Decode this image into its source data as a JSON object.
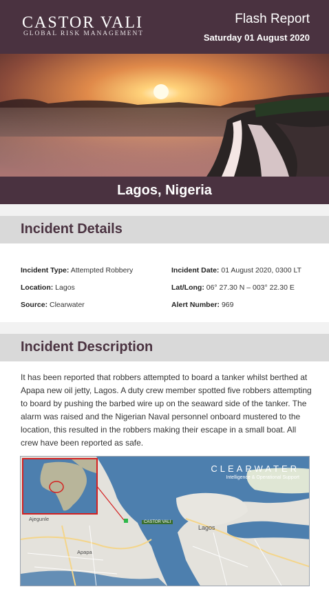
{
  "header": {
    "logo_main": "CASTOR VALI",
    "logo_sub": "GLOBAL RISK MANAGEMENT",
    "report_title": "Flash Report",
    "report_date": "Saturday 01 August 2020"
  },
  "location": "Lagos, Nigeria",
  "incident_details": {
    "heading": "Incident Details",
    "fields": [
      {
        "label": "Incident Type:",
        "value": "Attempted Robbery"
      },
      {
        "label": "Incident Date:",
        "value": "01 August 2020, 0300 LT"
      },
      {
        "label": "Location:",
        "value": "Lagos"
      },
      {
        "label": "Lat/Long:",
        "value": "06° 27.30 N – 003° 22.30 E"
      },
      {
        "label": "Source:",
        "value": "Clearwater"
      },
      {
        "label": "Alert Number:",
        "value": "969"
      }
    ]
  },
  "incident_description": {
    "heading": "Incident Description",
    "text": "It has been reported that robbers attempted to board a tanker whilst berthed at Apapa new oil jetty, Lagos. A duty crew member spotted five robbers attempting to board by pushing the barbed wire up on the seaward side of the tanker. The alarm was raised and the Nigerian Naval personnel onboard mustered to the location, this resulted in the robbers making their escape in a small boat. All crew have been reported as safe."
  },
  "map": {
    "brand": "CLEARWATER",
    "brand_sub": "Intelligence & Operational Support",
    "pin_label": "CASTOR VALI",
    "labels": {
      "lagos": "Lagos",
      "apapa": "Apapa",
      "ajegunle": "Ajegunle"
    }
  },
  "colors": {
    "brand": "#4a3240",
    "section_bg": "#d9d9d9",
    "heading": "#4a3240"
  }
}
